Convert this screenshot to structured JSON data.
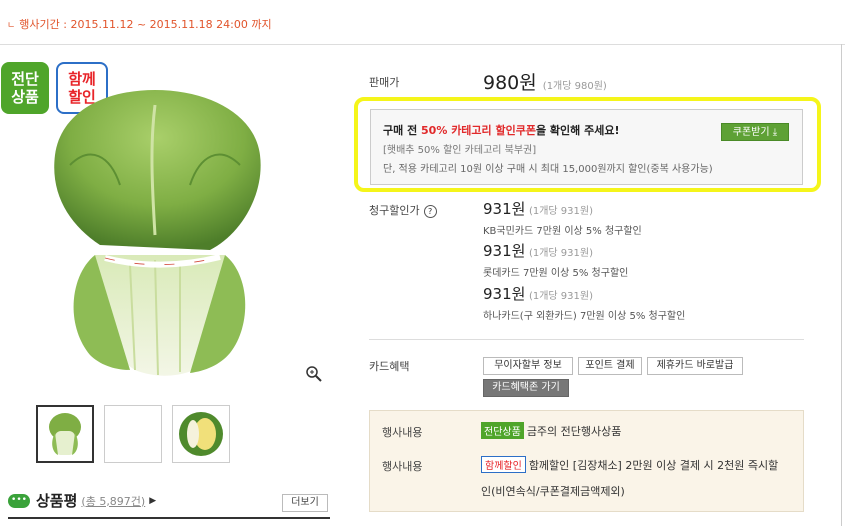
{
  "event": {
    "period": "행사기간 : 2015.11.12 ~ 2015.11.18 24:00 까지"
  },
  "badges": {
    "green_line1": "전단",
    "green_line2": "상품",
    "blue_line1": "함께",
    "blue_line2": "할인"
  },
  "colors": {
    "accent_orange": "#e1542b",
    "badge_green": "#4fa52a",
    "badge_blue": "#2c6fc7",
    "highlight_yellow": "#f5f51a",
    "coupon_btn": "#5ea135",
    "red": "#e1292a"
  },
  "review": {
    "title": "상품평",
    "count": "(총 5,897건)",
    "more": "더보기"
  },
  "price": {
    "label": "판매가",
    "value": "980원",
    "unit": "(1개당 980원)"
  },
  "coupon": {
    "pre": "구매 전 ",
    "highlight": "50% 카테고리 할인쿠폰",
    "post": "을 확인해 주세요!",
    "name": "[햇배추 50% 할인 카테고리 북부권]",
    "condition": "단, 적용 카테고리 10원 이상 구매 시 최대 15,000원까지 할인(중복 사용가능)",
    "button": "쿠폰받기"
  },
  "billing": {
    "label": "청구할인가",
    "help": "?",
    "items": [
      {
        "price": "931원",
        "unit": "(1개당 931원)",
        "card": "KB국민카드 7만원 이상 5% 청구할인"
      },
      {
        "price": "931원",
        "unit": "(1개당 931원)",
        "card": "롯데카드 7만원 이상 5% 청구할인"
      },
      {
        "price": "931원",
        "unit": "(1개당 931원)",
        "card": "하나카드(구 외환카드) 7만원 이상 5% 청구할인"
      }
    ]
  },
  "card_benefit": {
    "label": "카드혜택",
    "buttons": [
      "무이자할부 정보",
      "포인트 결제",
      "제휴카드 바로발급"
    ],
    "dark_button": "카드혜택존 가기"
  },
  "events": [
    {
      "label": "행사내용",
      "tag": "전단상품",
      "text": "금주의 전단행사상품"
    },
    {
      "label": "행사내용",
      "tag": "함께할인",
      "text": "함께할인 [김장채소] 2만원 이상 결제 시 2천원 즉시할",
      "text2": "인(비연속식/쿠폰결제금액제외)"
    }
  ],
  "icons": [
    "zoom-icon",
    "download-icon",
    "review-bubble-icon",
    "help-icon"
  ]
}
